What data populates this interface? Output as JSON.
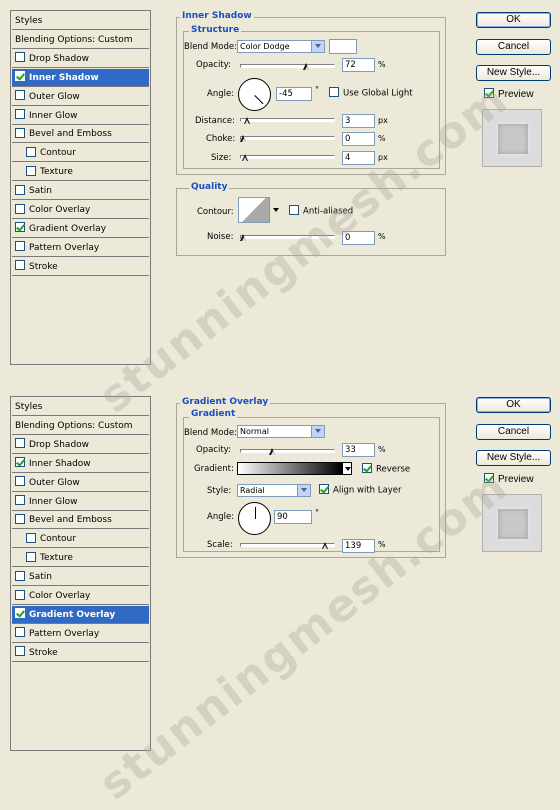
{
  "sidebar_items": [
    "Styles",
    "Blending Options: Custom",
    "Drop Shadow",
    "Inner Shadow",
    "Outer Glow",
    "Inner Glow",
    "Bevel and Emboss",
    "Contour",
    "Texture",
    "Satin",
    "Color Overlay",
    "Gradient Overlay",
    "Pattern Overlay",
    "Stroke"
  ],
  "buttons": {
    "ok": "OK",
    "cancel": "Cancel",
    "new_style": "New Style...",
    "preview": "Preview"
  },
  "top": {
    "checked": {
      "drop_shadow": false,
      "inner_shadow": true,
      "outer_glow": false,
      "inner_glow": false,
      "bevel": false,
      "contour": false,
      "texture": false,
      "satin": false,
      "color_overlay": false,
      "gradient_overlay": true,
      "pattern_overlay": false,
      "stroke": false
    },
    "selected": "Inner Shadow",
    "section_title": "Inner Shadow",
    "structure_title": "Structure",
    "blend_mode_label": "Blend Mode:",
    "blend_mode": "Color Dodge",
    "opacity_label": "Opacity:",
    "opacity": "72",
    "opacity_level": 72,
    "angle_label": "Angle:",
    "angle": "-45",
    "angle_unit": "°",
    "global_light_label": "Use Global Light",
    "global_light": false,
    "distance_label": "Distance:",
    "distance": "3",
    "distance_level": 0.04,
    "choke_label": "Choke:",
    "choke": "0",
    "choke_level": 0,
    "size_label": "Size:",
    "size": "4",
    "size_level": 0.02,
    "quality_title": "Quality",
    "contour_label": "Contour:",
    "anti_aliased_label": "Anti-aliased",
    "anti_aliased": false,
    "noise_label": "Noise:",
    "noise": "0",
    "noise_level": 0,
    "unit_pct": "%",
    "unit_px": "px"
  },
  "bottom": {
    "selected": "Gradient Overlay",
    "section_title": "Gradient Overlay",
    "gradient_title": "Gradient",
    "blend_mode_label": "Blend Mode:",
    "blend_mode": "Normal",
    "opacity_label": "Opacity:",
    "opacity": "33",
    "opacity_level": 33,
    "gradient_label": "Gradient:",
    "reverse_label": "Reverse",
    "reverse": true,
    "style_label": "Style:",
    "style": "Radial",
    "align_label": "Align with Layer",
    "align": true,
    "angle_label": "Angle:",
    "angle": "90",
    "angle_unit": "°",
    "scale_label": "Scale:",
    "scale": "139",
    "scale_level": 0.93,
    "unit_pct": "%"
  },
  "preview_checked": true,
  "watermark": "stunningmesh.com"
}
